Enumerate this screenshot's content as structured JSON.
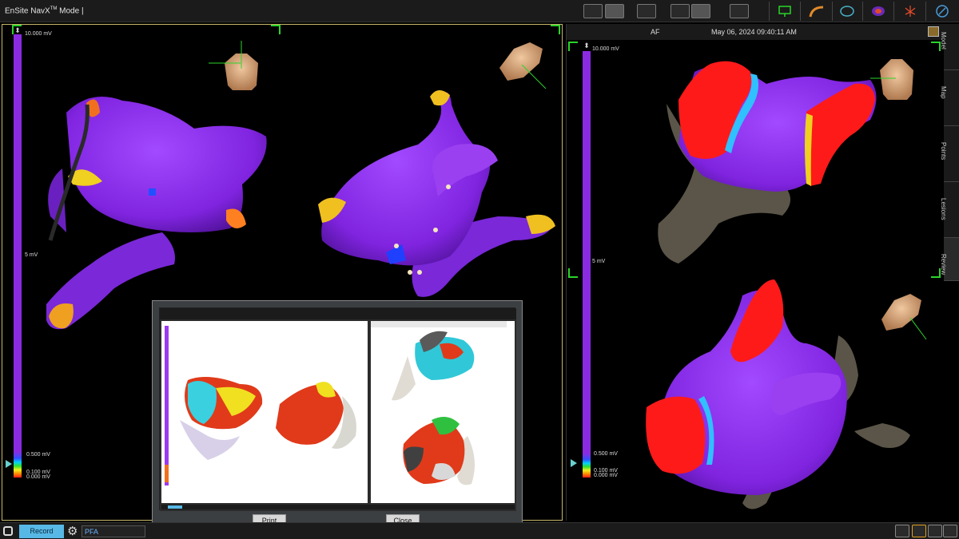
{
  "app": {
    "title_main": "EnSite NavX",
    "title_sup": "TM",
    "title_rest": " Mode | "
  },
  "left_scale": {
    "max": "10.000 mV",
    "mid": "5 mV",
    "low": "0.500 mV",
    "min_a": "0.100 mV",
    "min_b": "0.000 mV"
  },
  "right_panel": {
    "rhythm": "AF",
    "timestamp": "May 06, 2024 09:40:11 AM",
    "scale_max": "10.000 mV",
    "scale_mid": "5 mV",
    "scale_low": "0.500 mV",
    "scale_min_a": "0.100 mV",
    "scale_min_b": "0.000 mV"
  },
  "side_tabs": [
    "Model",
    "Map",
    "Points",
    "Lesions",
    "Review"
  ],
  "dialog": {
    "print_label": "Print",
    "close_label": "Close"
  },
  "bottom": {
    "record_label": "Record",
    "procedure_value": "PFA"
  },
  "colors": {
    "low_voltage": "#8a2be2",
    "scar": "#ff1a1a",
    "accent_green": "#2bd42b",
    "record_blue": "#57b8e6"
  }
}
